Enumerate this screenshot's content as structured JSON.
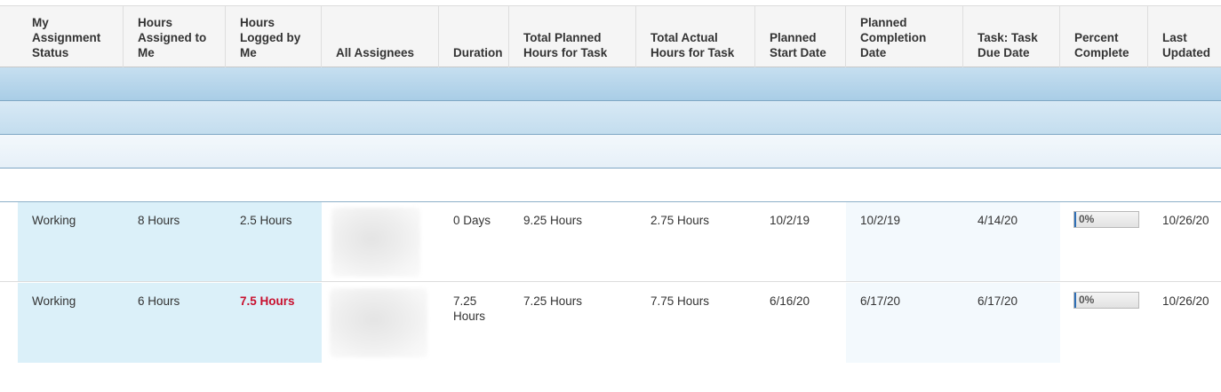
{
  "columns": [
    {
      "label": "My Assignment Status"
    },
    {
      "label": "Hours Assigned to Me"
    },
    {
      "label": "Hours Logged by Me"
    },
    {
      "label": "All Assignees"
    },
    {
      "label": "Duration"
    },
    {
      "label": "Total Planned Hours for Task"
    },
    {
      "label": "Total Actual Hours for Task"
    },
    {
      "label": "Planned Start Date"
    },
    {
      "label": "Planned Completion Date"
    },
    {
      "label": "Task: Task Due Date"
    },
    {
      "label": "Percent Complete"
    },
    {
      "label": "Last Updated"
    }
  ],
  "header_lines": {
    "status": [
      "My",
      "Assignment",
      "Status"
    ],
    "assigned": [
      "Hours",
      "Assigned to",
      "Me"
    ],
    "logged": [
      "Hours",
      "Logged by",
      "Me"
    ],
    "assignees": [
      "All Assignees"
    ],
    "duration": [
      "Duration"
    ],
    "planned_hours": [
      "Total Planned",
      "Hours for Task"
    ],
    "actual_hours": [
      "Total Actual",
      "Hours for Task"
    ],
    "start": [
      "Planned",
      "Start Date"
    ],
    "completion": [
      "Planned",
      "Completion Date"
    ],
    "due": [
      "Task: Task",
      "Due Date"
    ],
    "percent": [
      "Percent",
      "Complete"
    ],
    "updated": [
      "Last",
      "Updated"
    ]
  },
  "rows": [
    {
      "status": "Working",
      "assigned": "8 Hours",
      "logged": "2.5 Hours",
      "logged_over": false,
      "duration": [
        "0 Days"
      ],
      "planned_hours": "9.25 Hours",
      "actual_hours": "2.75 Hours",
      "start": "10/2/19",
      "completion": "10/2/19",
      "due": "4/14/20",
      "percent": "0%",
      "percent_value": 0,
      "updated": "10/26/20"
    },
    {
      "status": "Working",
      "assigned": "6 Hours",
      "logged": "7.5 Hours",
      "logged_over": true,
      "duration": [
        "7.25",
        "Hours"
      ],
      "planned_hours": "7.25 Hours",
      "actual_hours": "7.75 Hours",
      "start": "6/16/20",
      "completion": "6/17/20",
      "due": "6/17/20",
      "percent": "0%",
      "percent_value": 0,
      "updated": "10/26/20"
    }
  ],
  "colors": {
    "over_logged": "#c8102e",
    "assignment_highlight": "#dbf0f9",
    "progress_fill": "#2f6fb6"
  }
}
